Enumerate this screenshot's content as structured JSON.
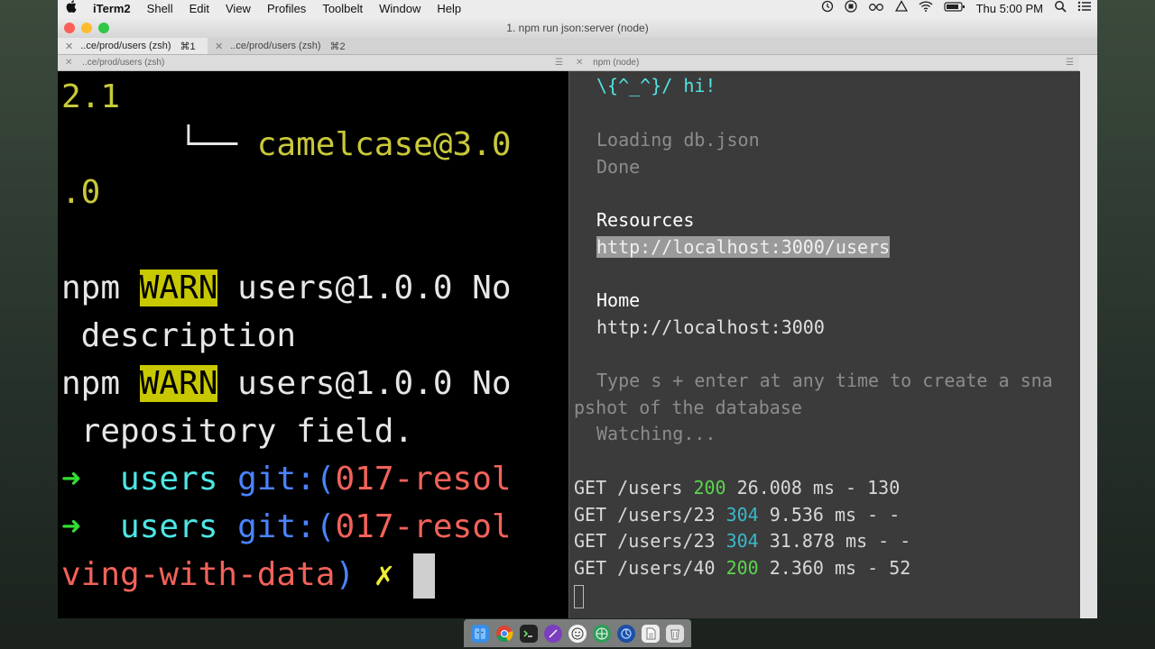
{
  "menubar": {
    "apple": "",
    "app": "iTerm2",
    "items": [
      "Shell",
      "Edit",
      "View",
      "Profiles",
      "Toolbelt",
      "Window",
      "Help"
    ],
    "clock": "Thu 5:00 PM"
  },
  "window": {
    "title": "1. npm run json:server (node)",
    "tabs": [
      {
        "label": "..ce/prod/users (zsh)",
        "shortcut": "⌘1"
      },
      {
        "label": "..ce/prod/users (zsh)",
        "shortcut": "⌘2"
      }
    ],
    "left_pane_title": "..ce/prod/users (zsh)",
    "right_pane_title": "npm (node)"
  },
  "left_terminal": {
    "line1": "2.1",
    "tree_prefix": "      └── ",
    "tree_pkg": "camelcase@3.0",
    "line3": ".0",
    "npm": "npm",
    "warn": "WARN",
    "warn1_rest": " users@1.0.0 No",
    "warn1_cont": " description",
    "warn2_rest": " users@1.0.0 No",
    "warn2_cont": " repository field.",
    "arrow": "➜",
    "dir": "users",
    "git_label": "git:(",
    "branch1": "017-resol",
    "branch2": "017-resol",
    "branch_cont": "ving-with-data",
    "close_paren": ")",
    "dirty": "✗"
  },
  "right_terminal": {
    "hi": "\\{^_^}/ hi!",
    "loading": "Loading db.json",
    "done": "Done",
    "resources": "Resources",
    "resources_url": "http://localhost:3000/users",
    "home": "Home",
    "home_url": "http://localhost:3000",
    "tip1": "Type s + enter at any time to create a sna",
    "tip2": "pshot of the database",
    "watching": "Watching...",
    "log": [
      {
        "req": "GET /users ",
        "status": "200",
        "rest": " 26.008 ms - 130"
      },
      {
        "req": "GET /users/23 ",
        "status": "304",
        "rest": " 9.536 ms - -"
      },
      {
        "req": "GET /users/23 ",
        "status": "304",
        "rest": " 31.878 ms - -"
      },
      {
        "req": "GET /users/40 ",
        "status": "200",
        "rest": " 2.360 ms - 52"
      }
    ]
  },
  "colors": {
    "left_bg": "#000000",
    "right_bg": "#3b3b3b",
    "warn_bg": "#c8c800",
    "prompt_cyan": "#4ee5e5",
    "branch_red": "#f2625a"
  },
  "dock_icons": [
    "finder-icon",
    "chrome-icon",
    "terminal-icon",
    "feather-icon",
    "emoji-icon",
    "globe-icon",
    "network-icon",
    "document-icon",
    "trash-icon"
  ]
}
